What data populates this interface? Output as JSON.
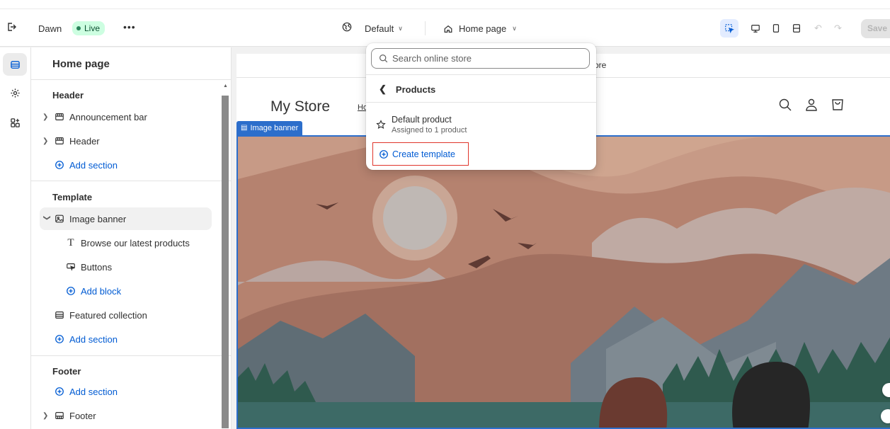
{
  "topbar": {
    "theme_name": "Dawn",
    "live_badge": "Live",
    "more": "•••",
    "template_selector": "Default",
    "page_selector": "Home page",
    "save_label": "Save"
  },
  "panel": {
    "title": "Home page",
    "header_group": {
      "title": "Header",
      "items": [
        "Announcement bar",
        "Header"
      ],
      "add_label": "Add section"
    },
    "template_group": {
      "title": "Template",
      "section": "Image banner",
      "blocks": [
        "Browse our latest products",
        "Buttons"
      ],
      "add_block_label": "Add block",
      "other_section": "Featured collection",
      "add_label": "Add section"
    },
    "footer_group": {
      "title": "Footer",
      "add_label": "Add section",
      "item": "Footer"
    }
  },
  "preview": {
    "announcement_text": "ore",
    "store_name": "My Store",
    "nav_link": "Ho",
    "banner_tag": "Image banner"
  },
  "popover": {
    "search_placeholder": "Search online store",
    "back_label": "Products",
    "item_title": "Default product",
    "item_subtitle": "Assigned to 1 product",
    "create_label": "Create template"
  },
  "colors": {
    "accent": "#005bd3",
    "live_bg": "#cdfee1",
    "highlight_border": "#e0352b",
    "selection": "#2c6ecb"
  }
}
